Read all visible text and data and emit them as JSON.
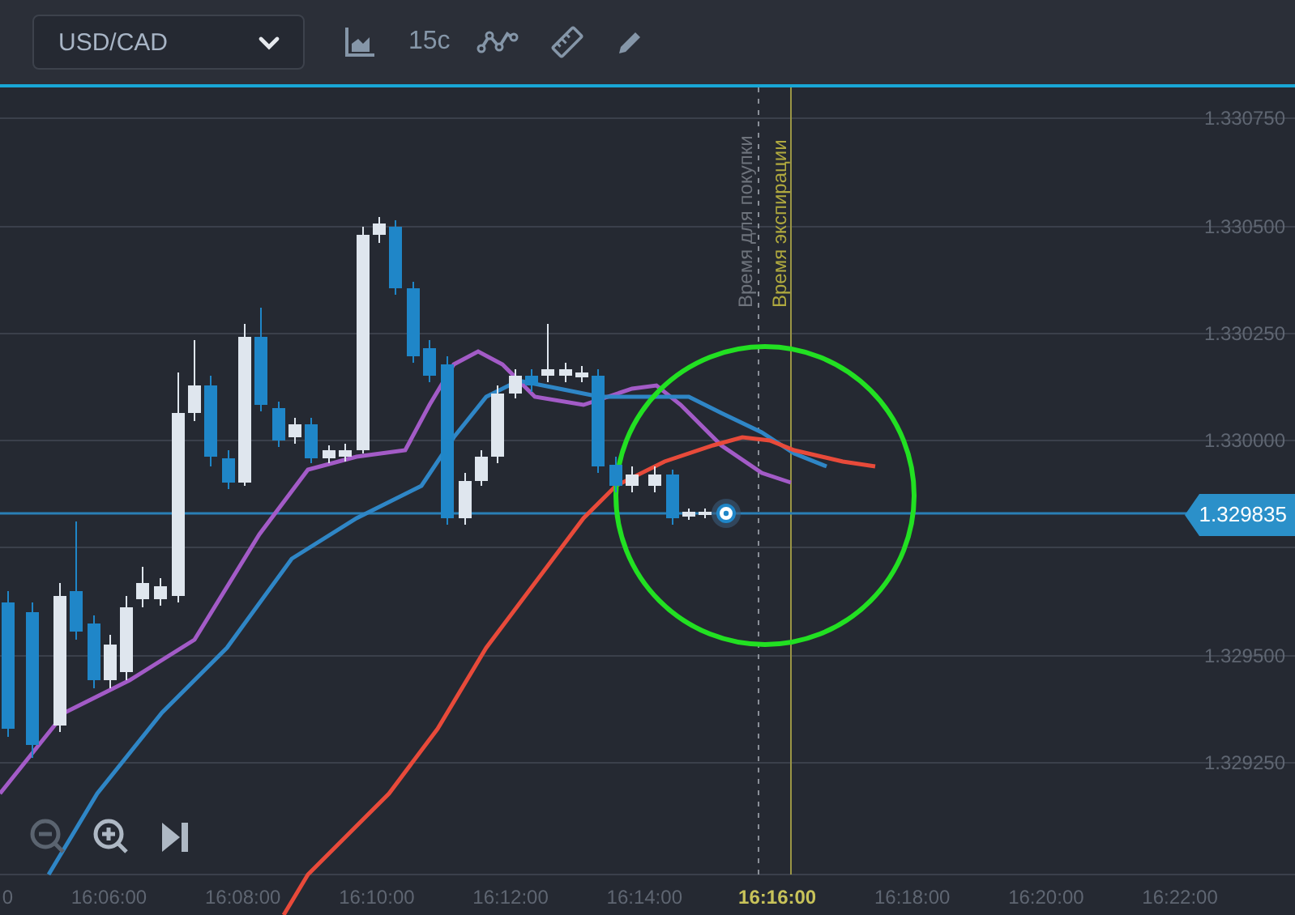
{
  "toolbar": {
    "symbol": "USD/CAD",
    "timeframe": "15c"
  },
  "price_axis": [
    "1.330750",
    "1.330500",
    "1.330250",
    "1.330000",
    "1.329500",
    "1.329250"
  ],
  "current_price": "1.329835",
  "markers": {
    "buy_time": "Время для покупки",
    "expiration_time": "Время экспирации"
  },
  "time_axis": [
    {
      "label": "0",
      "highlighted": false
    },
    {
      "label": "16:06:00",
      "highlighted": false
    },
    {
      "label": "16:08:00",
      "highlighted": false
    },
    {
      "label": "16:10:00",
      "highlighted": false
    },
    {
      "label": "16:12:00",
      "highlighted": false
    },
    {
      "label": "16:14:00",
      "highlighted": false
    },
    {
      "label": "16:16:00",
      "highlighted": true
    },
    {
      "label": "16:18:00",
      "highlighted": false
    },
    {
      "label": "16:20:00",
      "highlighted": false
    },
    {
      "label": "16:22:00",
      "highlighted": false
    }
  ]
}
